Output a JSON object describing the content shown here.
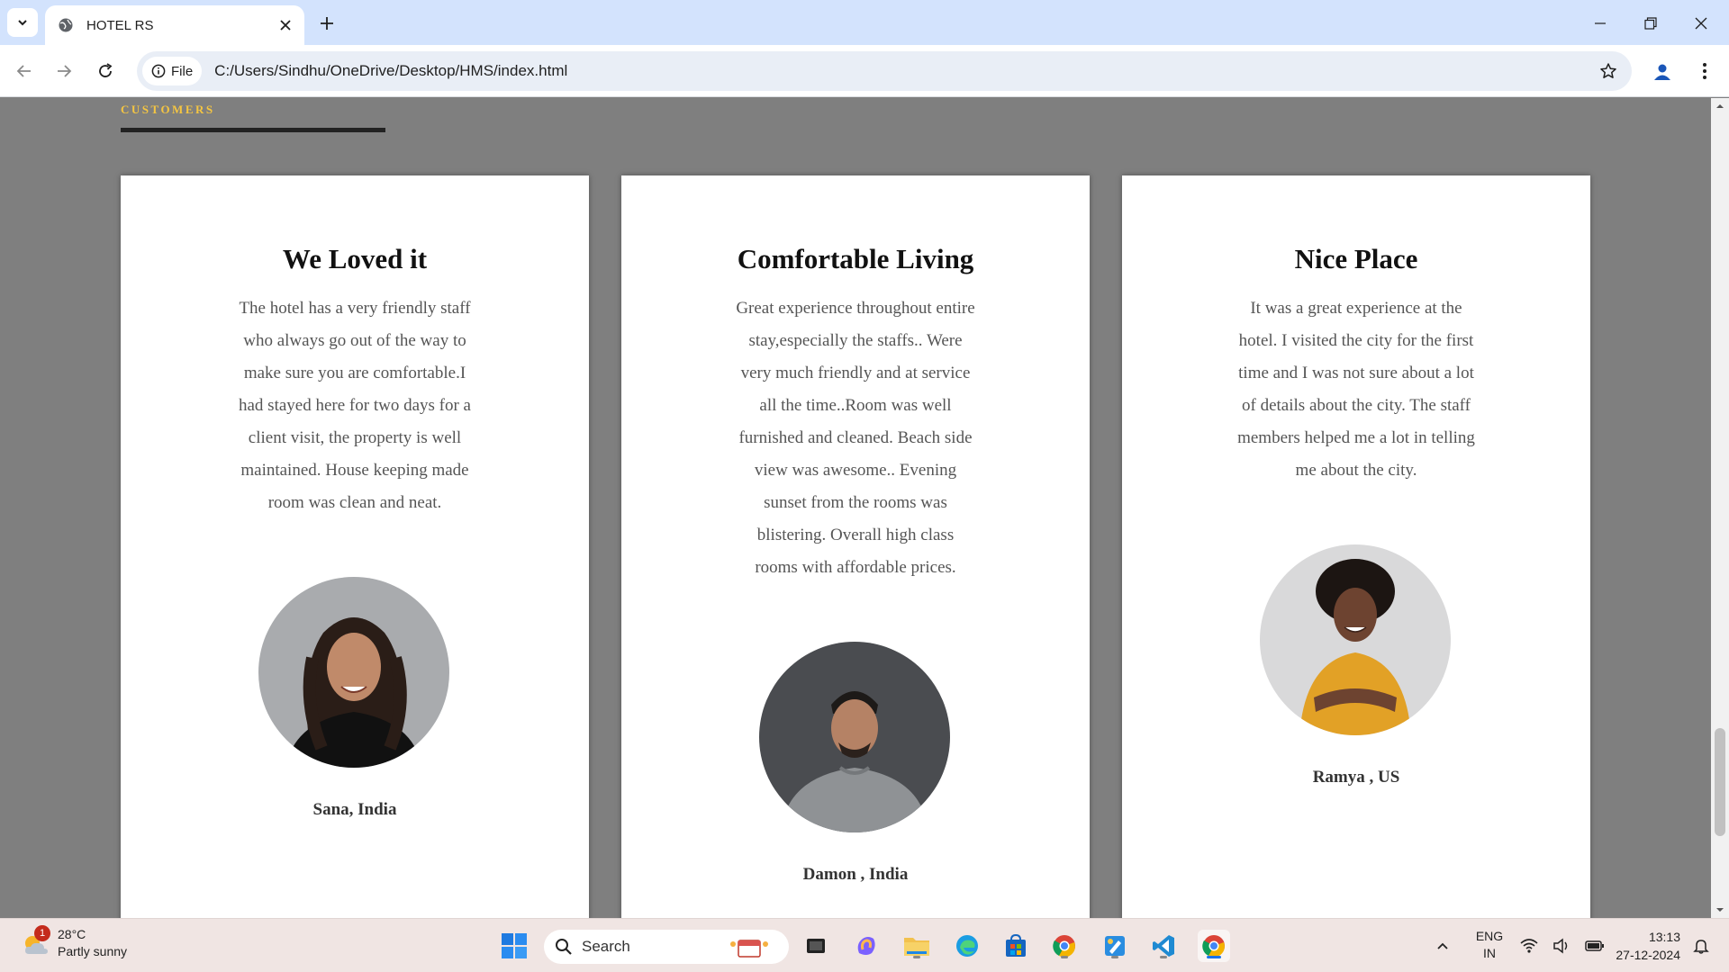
{
  "browser": {
    "tab_title": "HOTEL RS",
    "file_chip": "File",
    "url": "C:/Users/Sindhu/OneDrive/Desktop/HMS/index.html"
  },
  "page": {
    "section_label": "CUSTOMERS",
    "accent_color": "#f4c542",
    "testimonials": [
      {
        "title": "We Loved it",
        "review": "The hotel has a very friendly staff who always go out of the way to make sure you are comfortable.I had stayed here for two days for a client visit, the property is well maintained. House keeping made room was clean and neat.",
        "name": "Sana, India"
      },
      {
        "title": "Comfortable Living",
        "review": "Great experience throughout entire stay,especially the staffs.. Were very much friendly and at service all the time..Room was well furnished and cleaned. Beach side view was awesome.. Evening sunset from the rooms was blistering. Overall high class rooms with affordable prices.",
        "name": "Damon , India"
      },
      {
        "title": "Nice Place",
        "review": "It was a great experience at the hotel. I visited the city for the first time and I was not sure about a lot of details about the city. The staff members helped me a lot in telling me about the city.",
        "name": "Ramya , US"
      }
    ]
  },
  "taskbar": {
    "weather_badge": "1",
    "temperature": "28°C",
    "weather_desc": "Partly sunny",
    "search_placeholder": "Search",
    "lang_line1": "ENG",
    "lang_line2": "IN",
    "time": "13:13",
    "date": "27-12-2024"
  }
}
